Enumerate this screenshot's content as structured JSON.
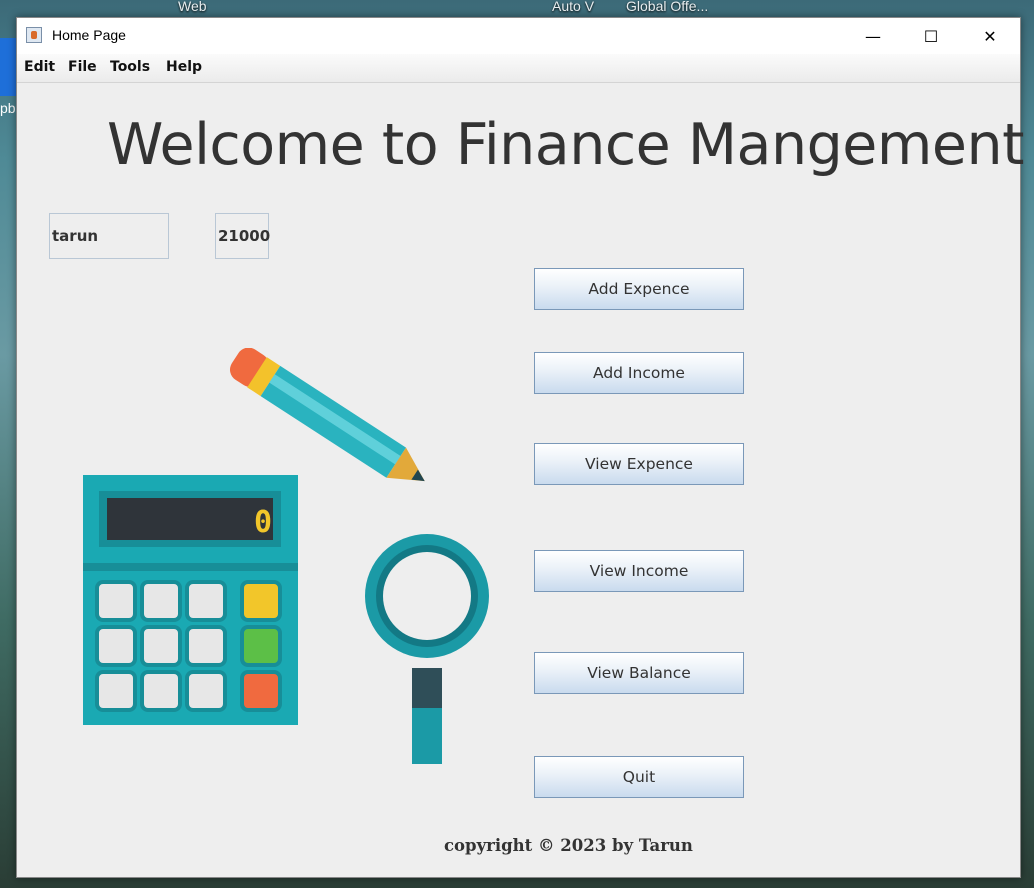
{
  "desktop": {
    "labels": [
      "Web",
      "Auto V",
      "Global Offe..."
    ],
    "icon_label": "pb"
  },
  "window": {
    "title": "Home Page",
    "minimize_glyph": "—",
    "maximize_glyph": "☐",
    "close_glyph": "✕"
  },
  "menu": {
    "items": [
      "Edit",
      "File",
      "Tools",
      "Help"
    ]
  },
  "main": {
    "heading": "Welcome to Finance Mangement",
    "user_name": "tarun",
    "balance": "21000",
    "buttons": {
      "add_expence": "Add Expence",
      "add_income": "Add Income",
      "view_expence": "View Expence",
      "view_income": "View Income",
      "view_balance": "View Balance",
      "quit": "Quit"
    },
    "calculator_display": "0",
    "copyright": "copyright © 2023 by Tarun"
  },
  "colors": {
    "calculator_body": "#1aa9b3",
    "calculator_dark": "#178e98",
    "display_bg": "#2f343a",
    "key_light": "#e7e7e7",
    "key_yellow": "#f2c62a",
    "key_green": "#5cbf47",
    "key_orange": "#f06a3f",
    "pencil_body": "#2ab3bf",
    "pencil_eraser": "#f06a3f",
    "pencil_band": "#f3c22b",
    "magnifier": "#1b9aa6"
  }
}
